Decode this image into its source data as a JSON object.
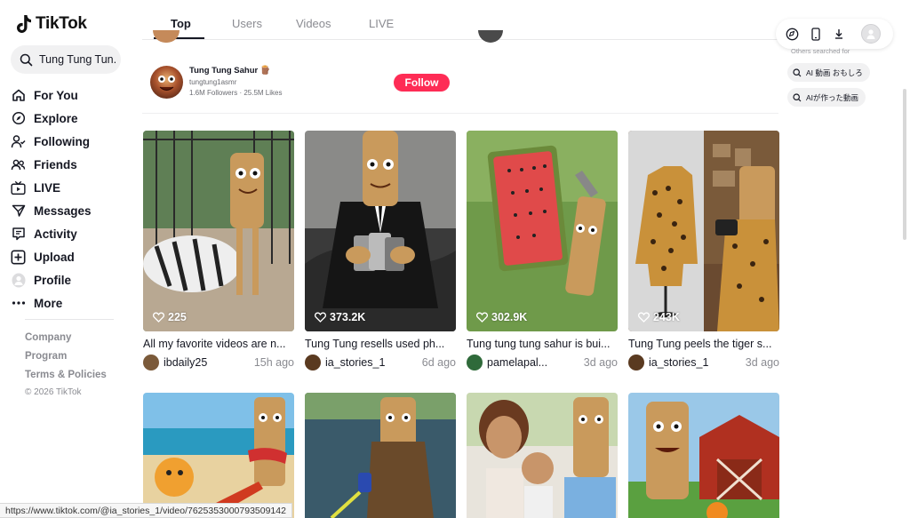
{
  "app": {
    "name": "TikTok"
  },
  "search": {
    "value": "Tung Tung Tun..."
  },
  "sidebar": {
    "items": [
      {
        "label": "For You",
        "icon": "home-icon"
      },
      {
        "label": "Explore",
        "icon": "compass-icon"
      },
      {
        "label": "Following",
        "icon": "following-icon"
      },
      {
        "label": "Friends",
        "icon": "friends-icon"
      },
      {
        "label": "LIVE",
        "icon": "live-icon"
      },
      {
        "label": "Messages",
        "icon": "messages-icon"
      },
      {
        "label": "Activity",
        "icon": "activity-icon"
      },
      {
        "label": "Upload",
        "icon": "upload-icon"
      },
      {
        "label": "Profile",
        "icon": "profile-icon"
      },
      {
        "label": "More",
        "icon": "more-icon"
      }
    ],
    "footer": {
      "company": "Company",
      "program": "Program",
      "terms": "Terms & Policies",
      "copyright": "© 2026 TikTok"
    }
  },
  "tabs": [
    {
      "label": "Top",
      "active": true
    },
    {
      "label": "Users",
      "active": false
    },
    {
      "label": "Videos",
      "active": false
    },
    {
      "label": "LIVE",
      "active": false
    }
  ],
  "user": {
    "name": "Tung Tung Sahur 🪵",
    "handle": "tungtung1asmr",
    "stats": "1.6M Followers  ·  25.5M Likes",
    "follow_label": "Follow"
  },
  "right_panel": {
    "others_label": "Others searched for",
    "chips": [
      "AI 動画 おもしろ",
      "AIが作った動画"
    ]
  },
  "videos": [
    {
      "likes": "225",
      "caption": "All my favorite videos are n...",
      "author": "ibdaily25",
      "time": "15h ago"
    },
    {
      "likes": "373.2K",
      "caption": "Tung Tung resells used ph...",
      "author": "ia_stories_1",
      "time": "6d ago"
    },
    {
      "likes": "302.9K",
      "caption": "Tung tung tung sahur is bui...",
      "author": "pamelapal...",
      "time": "3d ago"
    },
    {
      "likes": "243K",
      "caption": "Tung Tung peels the tiger s...",
      "author": "ia_stories_1",
      "time": "3d ago"
    }
  ],
  "status_url": "https://www.tiktok.com/@ia_stories_1/video/7625353000793509142",
  "colors": {
    "accent": "#fe2c55",
    "text": "#161823",
    "muted": "#8a8b91"
  }
}
